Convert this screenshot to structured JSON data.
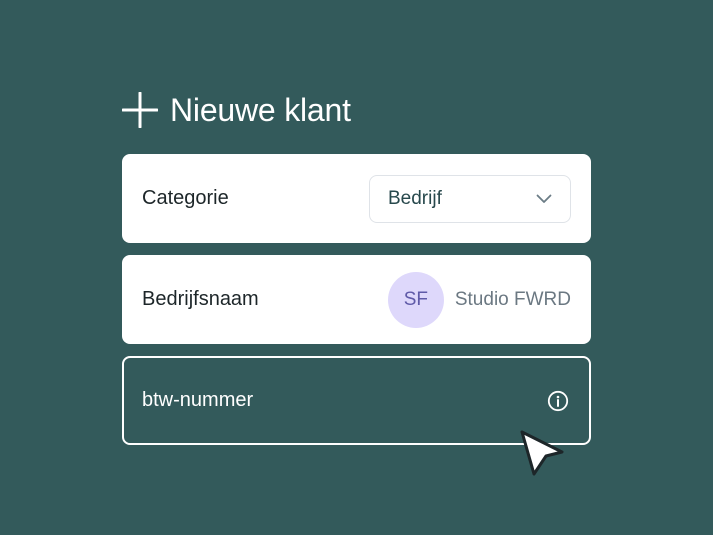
{
  "header": {
    "title": "Nieuwe klant",
    "icon": "plus-icon"
  },
  "form": {
    "categorie": {
      "label": "Categorie",
      "selected_value": "Bedrijf",
      "icon": "chevron-down-icon"
    },
    "bedrijfsnaam": {
      "label": "Bedrijfsnaam",
      "avatar_initials": "SF",
      "value": "Studio FWRD"
    },
    "btw_nummer": {
      "label": "btw-nummer",
      "icon": "info-icon"
    }
  },
  "cursor": {
    "icon": "mouse-pointer-icon"
  },
  "colors": {
    "background": "#335a5b",
    "card": "#ffffff",
    "avatar_bg": "#ded8fb",
    "avatar_text": "#5f5aa8",
    "text_dark": "#1d2629",
    "text_muted": "#6b7882"
  }
}
